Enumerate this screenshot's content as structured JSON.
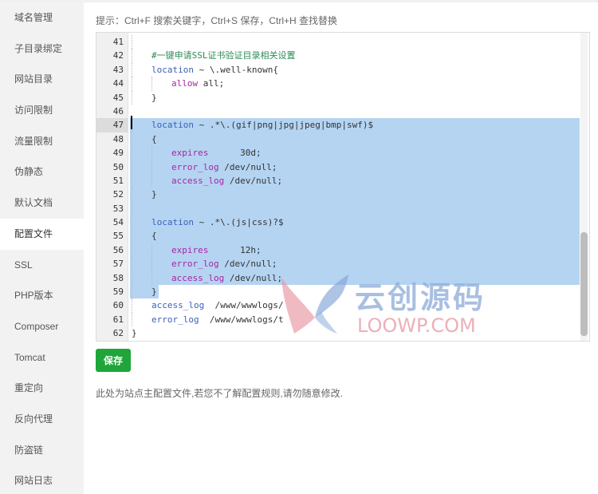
{
  "sidebar": {
    "items": [
      {
        "label": "域名管理"
      },
      {
        "label": "子目录绑定"
      },
      {
        "label": "网站目录"
      },
      {
        "label": "访问限制"
      },
      {
        "label": "流量限制"
      },
      {
        "label": "伪静态"
      },
      {
        "label": "默认文档"
      },
      {
        "label": "配置文件",
        "active": true
      },
      {
        "label": "SSL"
      },
      {
        "label": "PHP版本"
      },
      {
        "label": "Composer"
      },
      {
        "label": "Tomcat"
      },
      {
        "label": "重定向"
      },
      {
        "label": "反向代理"
      },
      {
        "label": "防盗链"
      },
      {
        "label": "网站日志"
      }
    ]
  },
  "hint": "提示：Ctrl+F 搜索关键字，Ctrl+S 保存，Ctrl+H 查找替换",
  "editor": {
    "current_line": "47",
    "lines": [
      {
        "n": "41",
        "indent": 1,
        "parts": []
      },
      {
        "n": "42",
        "indent": 1,
        "parts": [
          [
            "c-comment",
            "#一键申请SSL证书验证目录相关设置"
          ]
        ]
      },
      {
        "n": "43",
        "indent": 1,
        "parts": [
          [
            "c-kw",
            "location"
          ],
          [
            "c-var",
            " ~ \\.well-known{"
          ]
        ]
      },
      {
        "n": "44",
        "indent": 2,
        "parts": [
          [
            "c-dir",
            "allow"
          ],
          [
            "c-var",
            " all;"
          ]
        ]
      },
      {
        "n": "45",
        "indent": 1,
        "parts": [
          [
            "c-var",
            "}"
          ]
        ]
      },
      {
        "n": "46",
        "indent": 0,
        "parts": []
      },
      {
        "n": "47",
        "indent": 1,
        "sel": true,
        "parts": [
          [
            "c-kw",
            "location"
          ],
          [
            "c-var",
            " ~ .*\\.(gif|png|jpg|jpeg|bmp|swf)$"
          ]
        ]
      },
      {
        "n": "48",
        "indent": 1,
        "sel": true,
        "parts": [
          [
            "c-var",
            "{"
          ]
        ]
      },
      {
        "n": "49",
        "indent": 2,
        "sel": true,
        "parts": [
          [
            "c-dir",
            "expires"
          ],
          [
            "c-var",
            "      30d;"
          ]
        ]
      },
      {
        "n": "50",
        "indent": 2,
        "sel": true,
        "parts": [
          [
            "c-dir",
            "error_log"
          ],
          [
            "c-var",
            " /dev/null;"
          ]
        ]
      },
      {
        "n": "51",
        "indent": 2,
        "sel": true,
        "parts": [
          [
            "c-dir",
            "access_log"
          ],
          [
            "c-var",
            " /dev/null;"
          ]
        ]
      },
      {
        "n": "52",
        "indent": 1,
        "sel": true,
        "parts": [
          [
            "c-var",
            "}"
          ]
        ]
      },
      {
        "n": "53",
        "indent": 1,
        "sel": true,
        "parts": []
      },
      {
        "n": "54",
        "indent": 1,
        "sel": true,
        "parts": [
          [
            "c-kw",
            "location"
          ],
          [
            "c-var",
            " ~ .*\\.(js|css)?$"
          ]
        ]
      },
      {
        "n": "55",
        "indent": 1,
        "sel": true,
        "parts": [
          [
            "c-var",
            "{"
          ]
        ]
      },
      {
        "n": "56",
        "indent": 2,
        "sel": true,
        "parts": [
          [
            "c-dir",
            "expires"
          ],
          [
            "c-var",
            "      12h;"
          ]
        ]
      },
      {
        "n": "57",
        "indent": 2,
        "sel": true,
        "parts": [
          [
            "c-dir",
            "error_log"
          ],
          [
            "c-var",
            " /dev/null;"
          ]
        ]
      },
      {
        "n": "58",
        "indent": 2,
        "sel": true,
        "parts": [
          [
            "c-dir",
            "access_log"
          ],
          [
            "c-var",
            " /dev/null;"
          ]
        ]
      },
      {
        "n": "59",
        "indent": 1,
        "sel": "partial",
        "parts": [
          [
            "c-var",
            "}"
          ]
        ]
      },
      {
        "n": "60",
        "indent": 1,
        "parts": [
          [
            "c-kw",
            "access_log"
          ],
          [
            "c-var",
            "  /www/wwwlogs/"
          ]
        ]
      },
      {
        "n": "61",
        "indent": 1,
        "parts": [
          [
            "c-kw",
            "error_log"
          ],
          [
            "c-var",
            "  /www/wwwlogs/t"
          ]
        ]
      },
      {
        "n": "62",
        "indent": 0,
        "parts": [
          [
            "c-var",
            "}"
          ]
        ]
      }
    ]
  },
  "save_button": "保存",
  "note": "此处为站点主配置文件,若您不了解配置规则,请勿随意修改.",
  "watermark": {
    "cn": "云创源码",
    "en": "LOOWP.COM"
  },
  "colors": {
    "accent": "#20a53a",
    "selection": "#b5d4f2",
    "sidebar_bg": "#f2f2f2"
  }
}
